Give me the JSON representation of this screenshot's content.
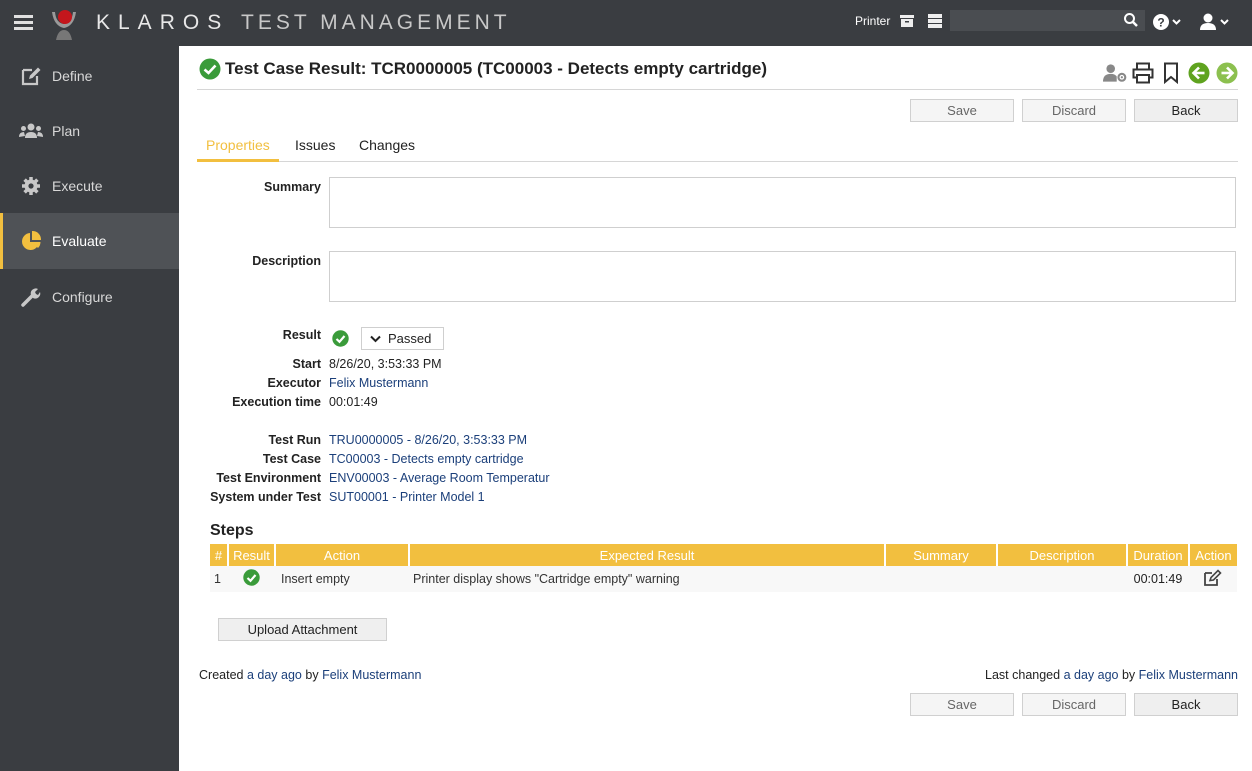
{
  "app": {
    "brand": "KLAROS",
    "brand_sub": "TEST MANAGEMENT",
    "project": "Printer",
    "search_placeholder": ""
  },
  "sidebar": {
    "items": [
      {
        "label": "Define",
        "icon": "edit-icon"
      },
      {
        "label": "Plan",
        "icon": "users-icon"
      },
      {
        "label": "Execute",
        "icon": "gear-icon"
      },
      {
        "label": "Evaluate",
        "icon": "pie-chart-icon",
        "active": true
      },
      {
        "label": "Configure",
        "icon": "wrench-icon"
      }
    ]
  },
  "page": {
    "title": "Test Case Result: TCR0000005 (TC00003 - Detects empty cartridge)",
    "buttons": {
      "save": "Save",
      "discard": "Discard",
      "back": "Back"
    },
    "tabs": [
      {
        "label": "Properties",
        "active": true
      },
      {
        "label": "Issues"
      },
      {
        "label": "Changes"
      }
    ]
  },
  "form": {
    "summary_label": "Summary",
    "summary_value": "",
    "description_label": "Description",
    "description_value": "",
    "result_label": "Result",
    "result_value": "Passed",
    "start_label": "Start",
    "start_value": "8/26/20, 3:53:33 PM",
    "executor_label": "Executor",
    "executor_value": "Felix Mustermann",
    "exec_time_label": "Execution time",
    "exec_time_value": "00:01:49",
    "test_run_label": "Test Run",
    "test_run_value": "TRU0000005 - 8/26/20, 3:53:33 PM",
    "test_case_label": "Test Case",
    "test_case_value": "TC00003 - Detects empty cartridge",
    "test_env_label": "Test Environment",
    "test_env_value": "ENV00003 - Average Room Temperatur",
    "sut_label": "System under Test",
    "sut_value": "SUT00001 - Printer Model 1"
  },
  "steps": {
    "heading": "Steps",
    "columns": [
      "#",
      "Result",
      "Action",
      "Expected Result",
      "Summary",
      "Description",
      "Duration",
      "Action"
    ],
    "rows": [
      {
        "num": "1",
        "result": "passed",
        "action": "Insert empty",
        "expected": "Printer display shows \"Cartridge empty\" warning",
        "summary": "",
        "description": "",
        "duration": "00:01:49"
      }
    ]
  },
  "upload_label": "Upload Attachment",
  "footer": {
    "created_prefix": "Created",
    "created_when": "a day ago",
    "by": "by",
    "created_by": "Felix Mustermann",
    "changed_prefix": "Last changed",
    "changed_when": "a day ago",
    "changed_by": "Felix Mustermann"
  },
  "colors": {
    "accent": "#f2bf3f",
    "success": "#3a9b3a",
    "nav_green": "#5fa31f"
  }
}
